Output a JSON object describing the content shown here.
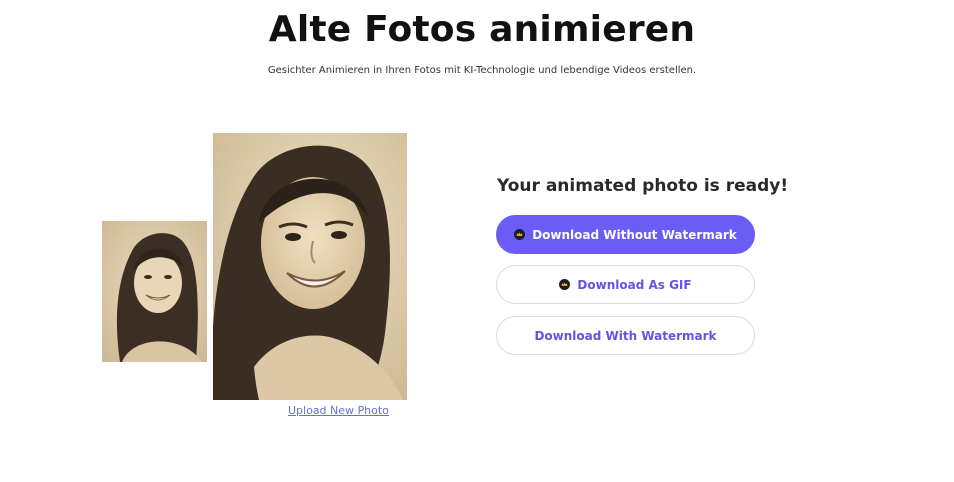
{
  "header": {
    "title": "Alte Fotos animieren",
    "subtitle": "Gesichter Animieren in Ihren Fotos mit KI-Technologie und lebendige Videos erstellen."
  },
  "photos": {
    "upload_label": "Upload New Photo"
  },
  "result": {
    "heading": "Your animated photo is ready!",
    "buttons": {
      "without_watermark": "Download Without Watermark",
      "gif": "Download As GIF",
      "with_watermark": "Download With Watermark"
    }
  },
  "colors": {
    "primary": "#6b5cf6",
    "link": "#6a6fd0",
    "badge": "#1b1b2a",
    "crown": "#f5b21a",
    "sepia_light": "#e6d6b8",
    "sepia_dark": "#3a2e22"
  },
  "icons": {
    "premium": "crown-icon"
  }
}
